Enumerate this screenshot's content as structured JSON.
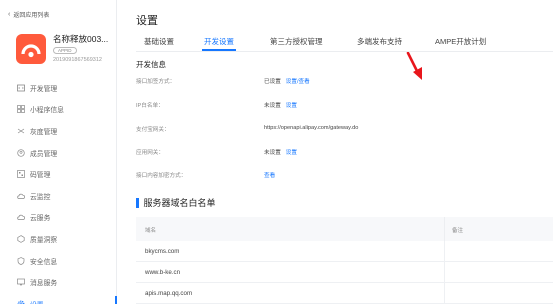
{
  "sidebar": {
    "back_label": "返回应用列表",
    "app": {
      "name": "名称释放003...",
      "badge": "APPID",
      "id": "2019091867569312"
    },
    "items": [
      {
        "label": "开发管理",
        "icon": "code-icon"
      },
      {
        "label": "小程序信息",
        "icon": "grid-icon"
      },
      {
        "label": "灰度管理",
        "icon": "gray-release-icon"
      },
      {
        "label": "成员管理",
        "icon": "member-icon"
      },
      {
        "label": "码管理",
        "icon": "qrcode-icon"
      },
      {
        "label": "云监控",
        "icon": "cloud-monitor-icon"
      },
      {
        "label": "云服务",
        "icon": "cloud-service-icon"
      },
      {
        "label": "质量洞察",
        "icon": "quality-icon"
      },
      {
        "label": "安全信息",
        "icon": "shield-icon"
      },
      {
        "label": "消息服务",
        "icon": "message-icon"
      },
      {
        "label": "设置",
        "icon": "gear-icon",
        "active": true
      }
    ]
  },
  "main": {
    "title": "设置",
    "tabs": [
      {
        "label": "基础设置"
      },
      {
        "label": "开发设置",
        "active": true
      },
      {
        "label": "第三方授权管理"
      },
      {
        "label": "多端发布支持"
      },
      {
        "label": "AMPE开放计划"
      }
    ],
    "dev_info": {
      "title": "开发信息",
      "rows": [
        {
          "label": "接口加签方式：",
          "status": "已设置",
          "link": "设置/查看"
        },
        {
          "label": "IP白名单：",
          "status": "未设置",
          "link": "设置"
        },
        {
          "label": "支付宝网关：",
          "value": "https://openapi.alipay.com/gateway.do"
        },
        {
          "label": "应用网关：",
          "status": "未设置",
          "link": "设置"
        },
        {
          "label": "接口内容加密方式：",
          "link": "查看"
        }
      ]
    },
    "whitelist": {
      "title": "服务器域名白名单",
      "columns": [
        "域名",
        "备注"
      ],
      "rows": [
        {
          "domain": "bkycms.com"
        },
        {
          "domain": "www.b-ke.cn"
        },
        {
          "domain": "apis.map.qq.com"
        }
      ]
    }
  },
  "colors": {
    "accent": "#1677ff",
    "logo": "#ff5a3c",
    "arrow": "#e8161c"
  }
}
